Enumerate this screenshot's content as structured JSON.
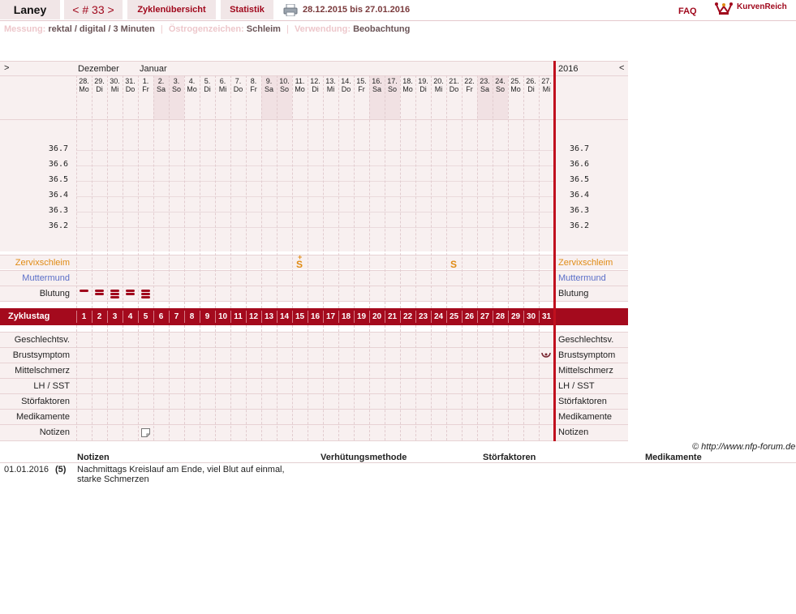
{
  "header": {
    "username": "Laney",
    "cycle_nav": {
      "prev": "<",
      "label": "# 33",
      "next": ">"
    },
    "tabs": [
      {
        "label": "Zyklenübersicht"
      },
      {
        "label": "Statistik"
      }
    ],
    "date_range": "28.12.2015 bis 27.01.2016",
    "faq": "FAQ",
    "brand": "KurvenReich"
  },
  "meta": {
    "messung_label": "Messung:",
    "messung_value": "rektal / digital / 3 Minuten",
    "oestrogen_label": "Östrogenzeichen:",
    "oestrogen_value": "Schleim",
    "verwendung_label": "Verwendung:",
    "verwendung_value": "Beobachtung"
  },
  "chart": {
    "nav_prev": ">",
    "nav_next": "<",
    "month_labels": [
      "Dezember",
      "Januar"
    ],
    "year_label": "2016",
    "days": [
      {
        "d": "28.",
        "w": "Mo",
        "we": false
      },
      {
        "d": "29.",
        "w": "Di",
        "we": false
      },
      {
        "d": "30.",
        "w": "Mi",
        "we": false
      },
      {
        "d": "31.",
        "w": "Do",
        "we": false
      },
      {
        "d": "1.",
        "w": "Fr",
        "we": false
      },
      {
        "d": "2.",
        "w": "Sa",
        "we": true
      },
      {
        "d": "3.",
        "w": "So",
        "we": true
      },
      {
        "d": "4.",
        "w": "Mo",
        "we": false
      },
      {
        "d": "5.",
        "w": "Di",
        "we": false
      },
      {
        "d": "6.",
        "w": "Mi",
        "we": false
      },
      {
        "d": "7.",
        "w": "Do",
        "we": false
      },
      {
        "d": "8.",
        "w": "Fr",
        "we": false
      },
      {
        "d": "9.",
        "w": "Sa",
        "we": true
      },
      {
        "d": "10.",
        "w": "So",
        "we": true
      },
      {
        "d": "11.",
        "w": "Mo",
        "we": false
      },
      {
        "d": "12.",
        "w": "Di",
        "we": false
      },
      {
        "d": "13.",
        "w": "Mi",
        "we": false
      },
      {
        "d": "14.",
        "w": "Do",
        "we": false
      },
      {
        "d": "15.",
        "w": "Fr",
        "we": false
      },
      {
        "d": "16.",
        "w": "Sa",
        "we": true
      },
      {
        "d": "17.",
        "w": "So",
        "we": true
      },
      {
        "d": "18.",
        "w": "Mo",
        "we": false
      },
      {
        "d": "19.",
        "w": "Di",
        "we": false
      },
      {
        "d": "20.",
        "w": "Mi",
        "we": false
      },
      {
        "d": "21.",
        "w": "Do",
        "we": false
      },
      {
        "d": "22.",
        "w": "Fr",
        "we": false
      },
      {
        "d": "23.",
        "w": "Sa",
        "we": true
      },
      {
        "d": "24.",
        "w": "So",
        "we": true
      },
      {
        "d": "25.",
        "w": "Mo",
        "we": false
      },
      {
        "d": "26.",
        "w": "Di",
        "we": false
      },
      {
        "d": "27.",
        "w": "Mi",
        "we": false
      }
    ],
    "temp_ticks": [
      "36.7",
      "36.6",
      "36.5",
      "36.4",
      "36.3",
      "36.2"
    ],
    "rows_top": [
      "Zervixschleim",
      "Muttermund",
      "Blutung"
    ],
    "cycle_label": "Zyklustag",
    "cycle_days": [
      "1",
      "2",
      "3",
      "4",
      "5",
      "6",
      "7",
      "8",
      "9",
      "10",
      "11",
      "12",
      "13",
      "14",
      "15",
      "16",
      "17",
      "18",
      "19",
      "20",
      "21",
      "22",
      "23",
      "24",
      "25",
      "26",
      "27",
      "28",
      "29",
      "30",
      "31"
    ],
    "rows_bottom": [
      "Geschlechtsv.",
      "Brustsymptom",
      "Mittelschmerz",
      "LH / SST",
      "Störfaktoren",
      "Medikamente",
      "Notizen"
    ],
    "mucus_marks": [
      {
        "day": 15,
        "symbol": "S",
        "plus": "+"
      },
      {
        "day": 25,
        "symbol": "S",
        "plus": ""
      }
    ],
    "bleeding": [
      {
        "day": 1,
        "level": 1
      },
      {
        "day": 2,
        "level": 2
      },
      {
        "day": 3,
        "level": 3
      },
      {
        "day": 4,
        "level": 2
      },
      {
        "day": 5,
        "level": 3
      }
    ],
    "breast_symptom_day": 31,
    "note_day": 5
  },
  "copyright": "© http://www.nfp-forum.de",
  "notes_table": {
    "headers": [
      "Notizen",
      "Verhütungsmethode",
      "Störfaktoren",
      "Medikamente"
    ],
    "rows": [
      {
        "date": "01.01.2016",
        "day": "(5)",
        "note": "Nachmittags Kreislauf am Ende, viel Blut auf einmal, starke Schmerzen"
      }
    ]
  },
  "colors": {
    "accent": "#a0081c",
    "mucus": "#e08b14",
    "muttermund": "#5a6ec8",
    "row_bg": "#f8f0f0"
  }
}
